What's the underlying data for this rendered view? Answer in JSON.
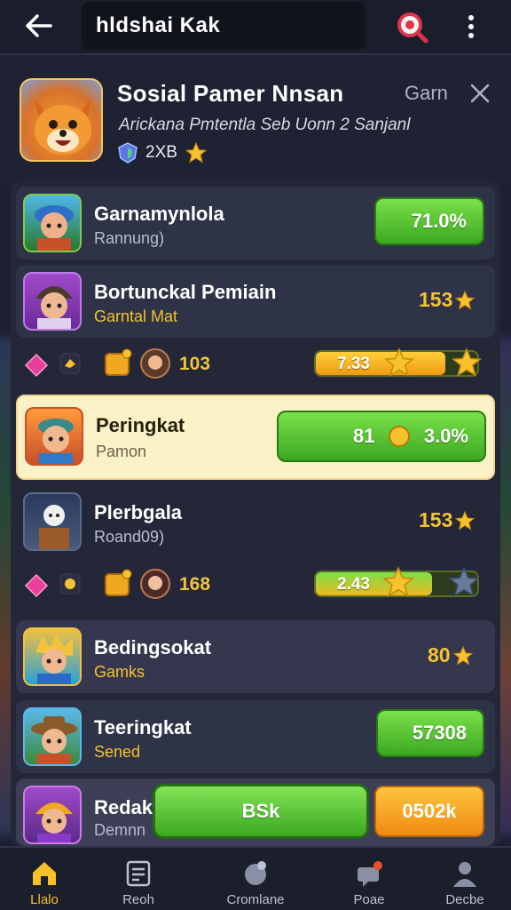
{
  "topbar": {
    "search_text": "hldshai Kak"
  },
  "header": {
    "title": "Sosial Pamer Nnsan",
    "tag": "Garn",
    "subtitle": "Arickana Pmtentla Seb Uonn 2 Sanjanl",
    "meta": "2XB"
  },
  "rows": [
    {
      "title": "Garnamynlola",
      "sub": "Rannung)",
      "value": "71.0%"
    },
    {
      "title": "Bortunckal Pemiain",
      "sub": "Garntal Mat",
      "value": "153"
    },
    {
      "title": "Peringkat",
      "sub": "Pamon",
      "value_a": "81",
      "value_b": "3.0%"
    },
    {
      "title": "Plerbgala",
      "sub": "Roand09)",
      "value": "153"
    },
    {
      "title": "Bedingsokat",
      "sub": "Gamks",
      "value": "80"
    },
    {
      "title": "Teeringkat",
      "sub": "Sened",
      "value": "57308"
    },
    {
      "title": "Redak",
      "sub": "Demnn",
      "value": "0502k"
    }
  ],
  "stats": [
    {
      "count": "103",
      "bar_label": "7.33",
      "level": 0.8
    },
    {
      "count": "168",
      "bar_label": "2.43",
      "level": 0.72
    }
  ],
  "cta": {
    "label": "BSk"
  },
  "nav": [
    {
      "label": "Llalo",
      "icon": "home-icon"
    },
    {
      "label": "Reoh",
      "icon": "document-icon"
    },
    {
      "label": "Cromlane",
      "icon": "chat-icon"
    },
    {
      "label": "Poae",
      "icon": "gift-icon"
    },
    {
      "label": "Decbe",
      "icon": "profile-icon"
    }
  ],
  "colors": {
    "accent_green": "#4cc12a",
    "accent_gold": "#f7c22e",
    "accent_orange": "#f59a1a",
    "background": "#1c2030"
  }
}
